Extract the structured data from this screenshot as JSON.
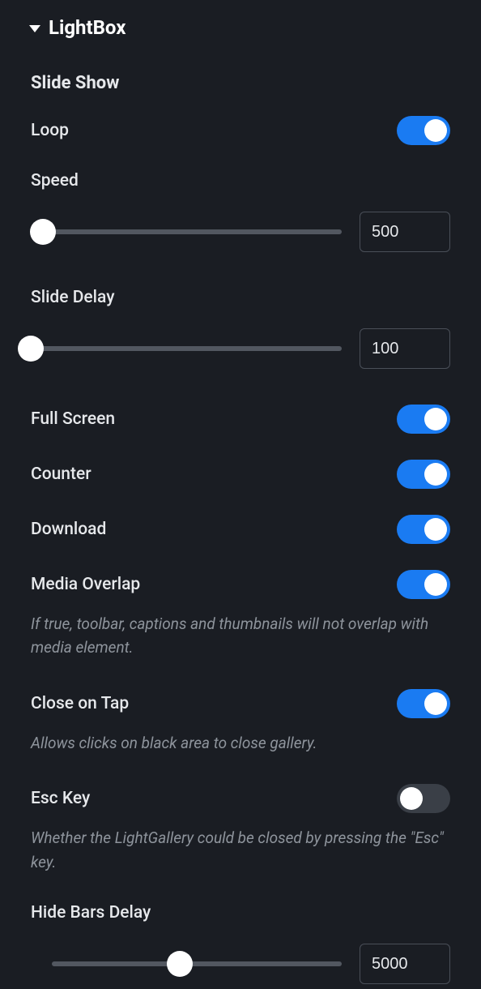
{
  "section": {
    "title": "LightBox"
  },
  "slideshow": {
    "title": "Slide Show",
    "loop": {
      "label": "Loop",
      "on": true
    },
    "speed": {
      "label": "Speed",
      "value": "500",
      "thumb_pct": 4
    },
    "slide_delay": {
      "label": "Slide Delay",
      "value": "100",
      "thumb_pct": 0
    },
    "full_screen": {
      "label": "Full Screen",
      "on": true
    },
    "counter": {
      "label": "Counter",
      "on": true
    },
    "download": {
      "label": "Download",
      "on": true
    },
    "media_overlap": {
      "label": "Media Overlap",
      "on": true,
      "desc": "If true, toolbar, captions and thumbnails will not overlap with media element."
    },
    "close_on_tap": {
      "label": "Close on Tap",
      "on": true,
      "desc": "Allows clicks on black area to close gallery."
    },
    "esc_key": {
      "label": "Esc Key",
      "on": false,
      "desc": "Whether the LightGallery could be closed by pressing the \"Esc\" key."
    },
    "hide_bars_delay": {
      "label": "Hide Bars Delay",
      "value": "5000",
      "thumb_pct": 44
    }
  }
}
